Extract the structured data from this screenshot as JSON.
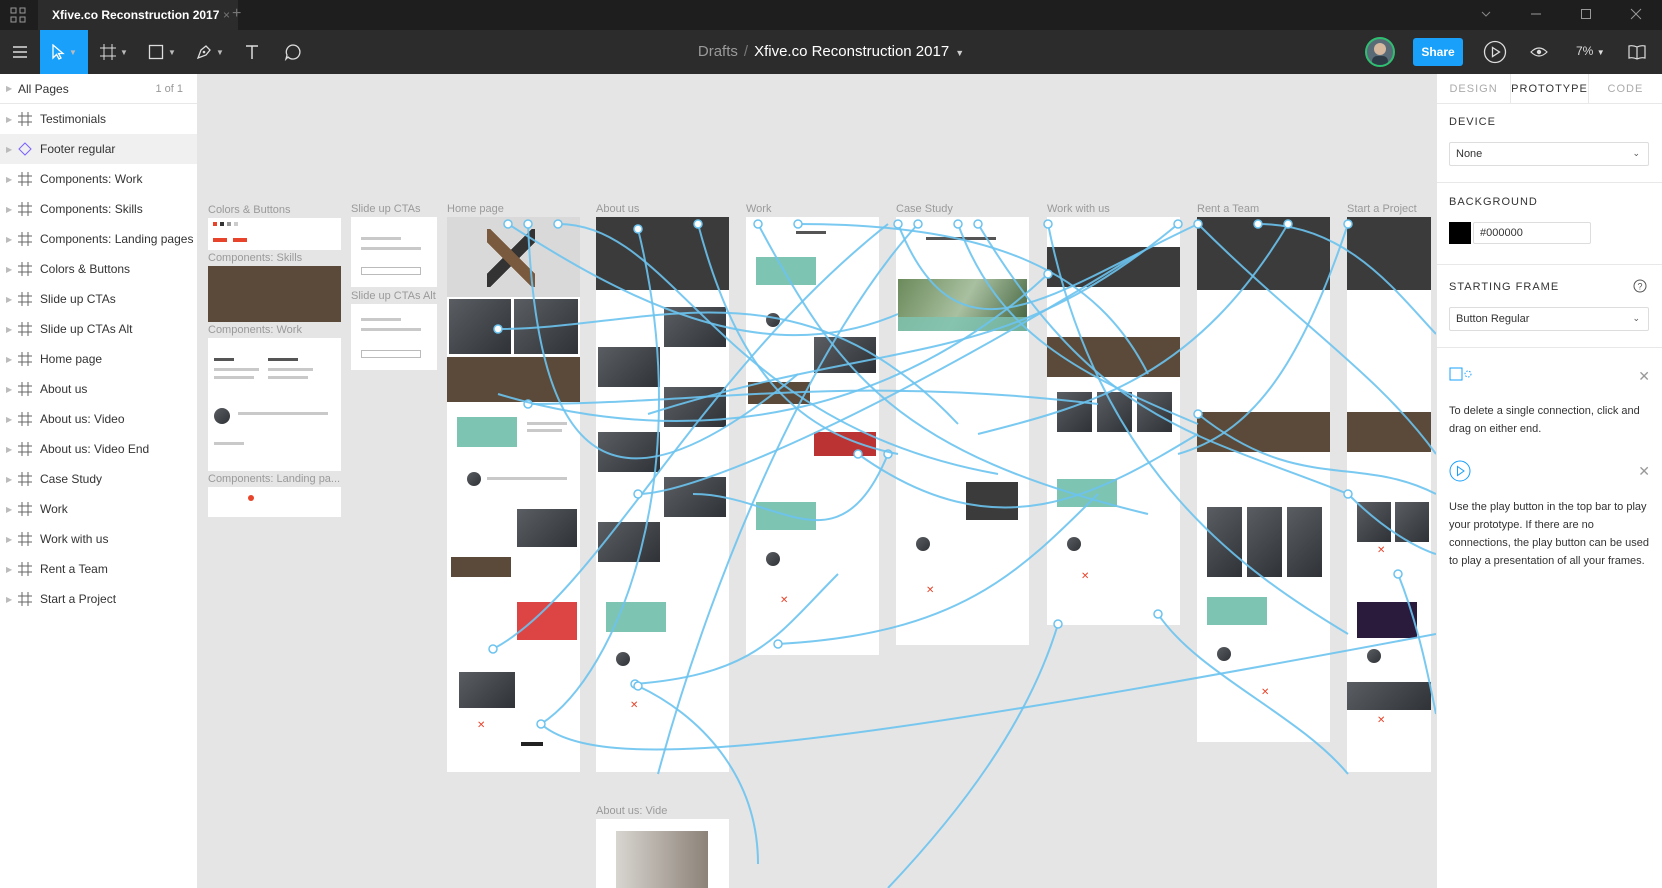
{
  "window": {
    "tab_title": "Xfive.co Reconstruction 2017",
    "tab_close": "×",
    "new_tab": "+"
  },
  "toolbar": {
    "breadcrumb_root": "Drafts",
    "breadcrumb_separator": "/",
    "file_name": "Xfive.co Reconstruction 2017",
    "share_label": "Share",
    "zoom_level": "7%",
    "accent_color": "#18a0fb"
  },
  "pages": {
    "header": "All Pages",
    "count": "1 of 1",
    "layers": [
      "Testimonials",
      "Footer regular",
      "Components: Work",
      "Components: Skills",
      "Components: Landing pages",
      "Colors & Buttons",
      "Slide up CTAs",
      "Slide up CTAs Alt",
      "Home page",
      "About us",
      "About us: Video",
      "About us: Video End",
      "Case Study",
      "Work",
      "Work with us",
      "Rent a Team",
      "Start a Project"
    ],
    "selected_layer": "Footer regular"
  },
  "canvas": {
    "frame_labels": {
      "colors_buttons": "Colors & Buttons",
      "comp_skills": "Components: Skills",
      "comp_work": "Components: Work",
      "comp_landing": "Components: Landing pa...",
      "slide_up": "Slide up CTAs",
      "slide_up_alt": "Slide up CTAs Alt",
      "home": "Home page",
      "about": "About us",
      "work": "Work",
      "case_study": "Case Study",
      "work_with_us": "Work with us",
      "rent_team": "Rent a Team",
      "start_project": "Start a Project",
      "about_video": "About us: Vide"
    },
    "wire_color": "#6cc3ef"
  },
  "inspector": {
    "tabs": [
      "DESIGN",
      "PROTOTYPE",
      "CODE"
    ],
    "active_tab": "PROTOTYPE",
    "device_title": "DEVICE",
    "device_value": "None",
    "background_title": "BACKGROUND",
    "background_value": "#000000",
    "starting_frame_title": "STARTING FRAME",
    "starting_frame_value": "Button Regular",
    "help_glyph": "?",
    "hint_connection": "To delete a single connection, click and drag on either end.",
    "hint_play": "Use the play button in the top bar to play your prototype. If there are no connections, the play button can be used to play a presentation of all your frames."
  }
}
